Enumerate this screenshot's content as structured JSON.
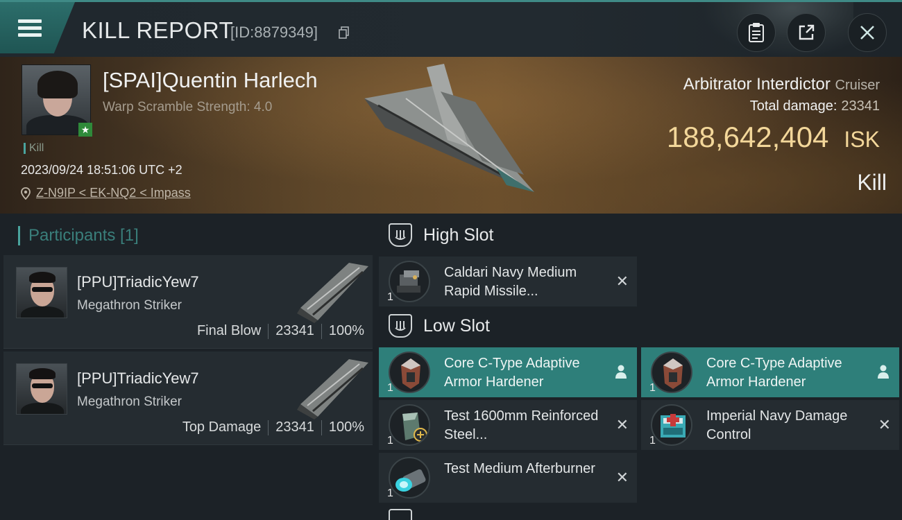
{
  "header": {
    "title": "KILL REPORT",
    "report_id": "[ID:8879349]",
    "icons": [
      "menu-icon",
      "copy-icon",
      "clipboard-icon",
      "share-icon",
      "close-icon"
    ]
  },
  "victim": {
    "name": "[SPAI]Quentin Harlech",
    "warp_scramble": "Warp Scramble Strength: 4.0",
    "tag": "Kill",
    "datetime": "2023/09/24 18:51:06 UTC +2",
    "location": "Z-N9IP < EK-NQ2 < Impass",
    "ship_name": "Arbitrator Interdictor",
    "ship_class": "Cruiser",
    "total_damage_label": "Total damage:",
    "total_damage": "23341",
    "isk_value": "188,642,404",
    "isk_unit": "ISK",
    "result": "Kill"
  },
  "participants": {
    "header": "Participants [1]",
    "rows": [
      {
        "name": "[PPU]TriadicYew7",
        "ship": "Megathron Striker",
        "label": "Final Blow",
        "damage": "23341",
        "percent": "100%"
      },
      {
        "name": "[PPU]TriadicYew7",
        "ship": "Megathron Striker",
        "label": "Top Damage",
        "damage": "23341",
        "percent": "100%"
      }
    ]
  },
  "fitting": {
    "high_slot": {
      "label": "High Slot",
      "modules": [
        {
          "name": "Caldari Navy Medium Rapid Missile...",
          "qty": "1",
          "state": "destroyed"
        }
      ]
    },
    "low_slot": {
      "label": "Low Slot",
      "modules": [
        {
          "name": "Core C-Type Adaptive Armor Hardener",
          "qty": "1",
          "state": "dropped"
        },
        {
          "name": "Core C-Type Adaptive Armor Hardener",
          "qty": "1",
          "state": "dropped"
        },
        {
          "name": "Test 1600mm Reinforced Steel...",
          "qty": "1",
          "state": "destroyed"
        },
        {
          "name": "Imperial Navy Damage Control",
          "qty": "1",
          "state": "destroyed"
        },
        {
          "name": "Test Medium Afterburner",
          "qty": "1",
          "state": "destroyed"
        }
      ]
    }
  },
  "colors": {
    "accent_teal": "#2e7f7a",
    "isk_gold": "#f3d79a"
  }
}
